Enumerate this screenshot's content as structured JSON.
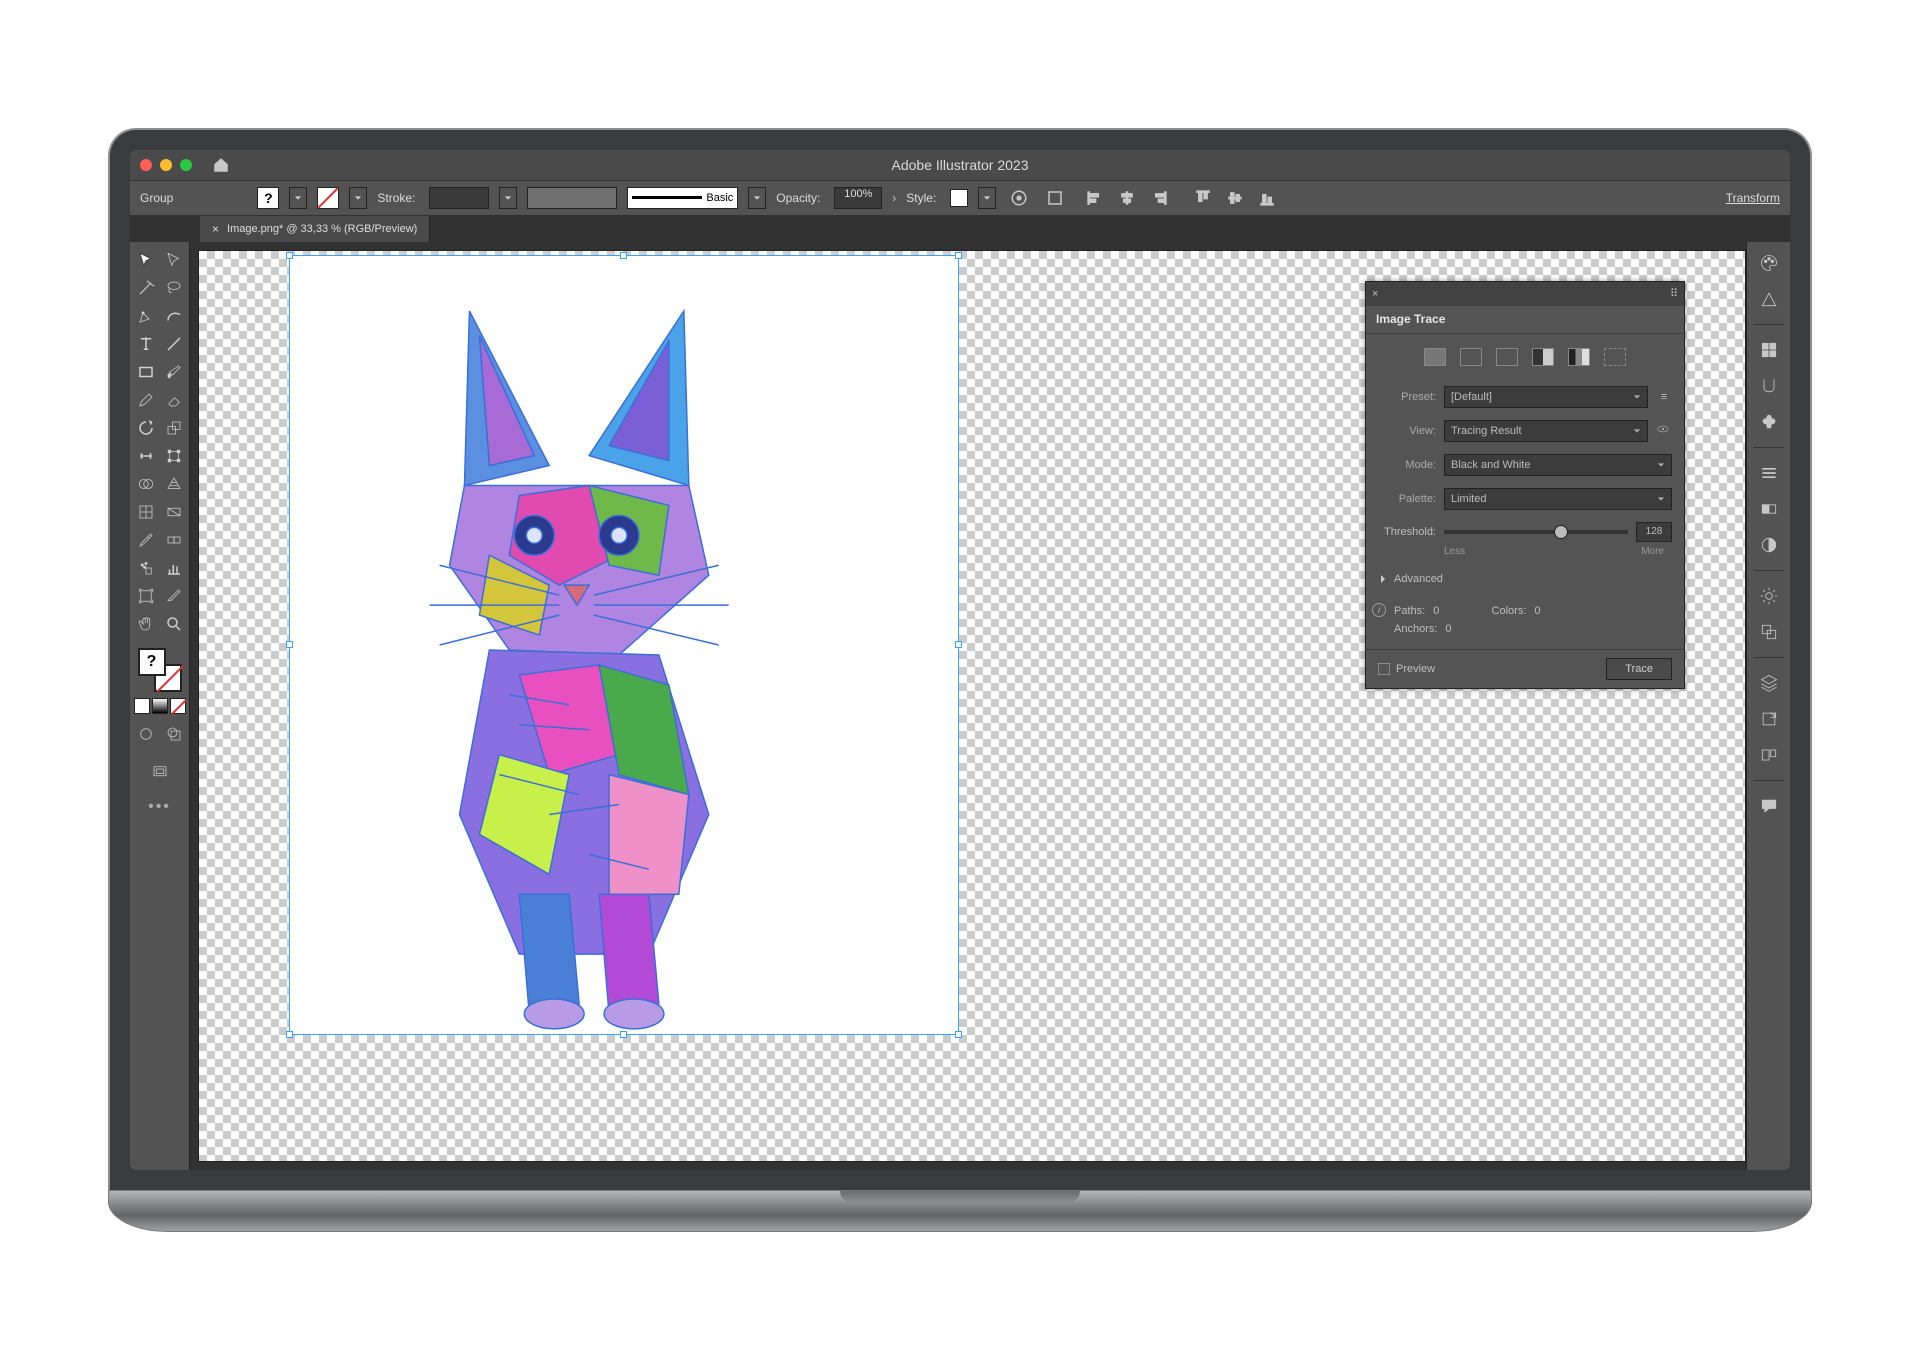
{
  "app_title": "Adobe Illustrator 2023",
  "controlbar": {
    "object_label": "Group",
    "fill_label": "?",
    "stroke_label": "Stroke:",
    "brush_label": "Basic",
    "opacity_label": "Opacity:",
    "opacity_value": "100%",
    "style_label": "Style:",
    "transform_label": "Transform"
  },
  "tabs": {
    "close_glyph": "×",
    "title": "Image.png* @ 33,33 % (RGB/Preview)"
  },
  "image_trace": {
    "panel_title": "Image Trace",
    "preset_label": "Preset:",
    "preset_value": "[Default]",
    "view_label": "View:",
    "view_value": "Tracing Result",
    "mode_label": "Mode:",
    "mode_value": "Black and White",
    "palette_label": "Palette:",
    "palette_value": "Limited",
    "threshold_label": "Threshold:",
    "threshold_value": "128",
    "threshold_less": "Less",
    "threshold_more": "More",
    "advanced_label": "Advanced",
    "paths_label": "Paths:",
    "paths_value": "0",
    "colors_label": "Colors:",
    "colors_value": "0",
    "anchors_label": "Anchors:",
    "anchors_value": "0",
    "preview_label": "Preview",
    "trace_button": "Trace"
  },
  "colors": {
    "ui_dark": "#535353",
    "ui_darker": "#323232",
    "selection": "#3aa0ff"
  }
}
